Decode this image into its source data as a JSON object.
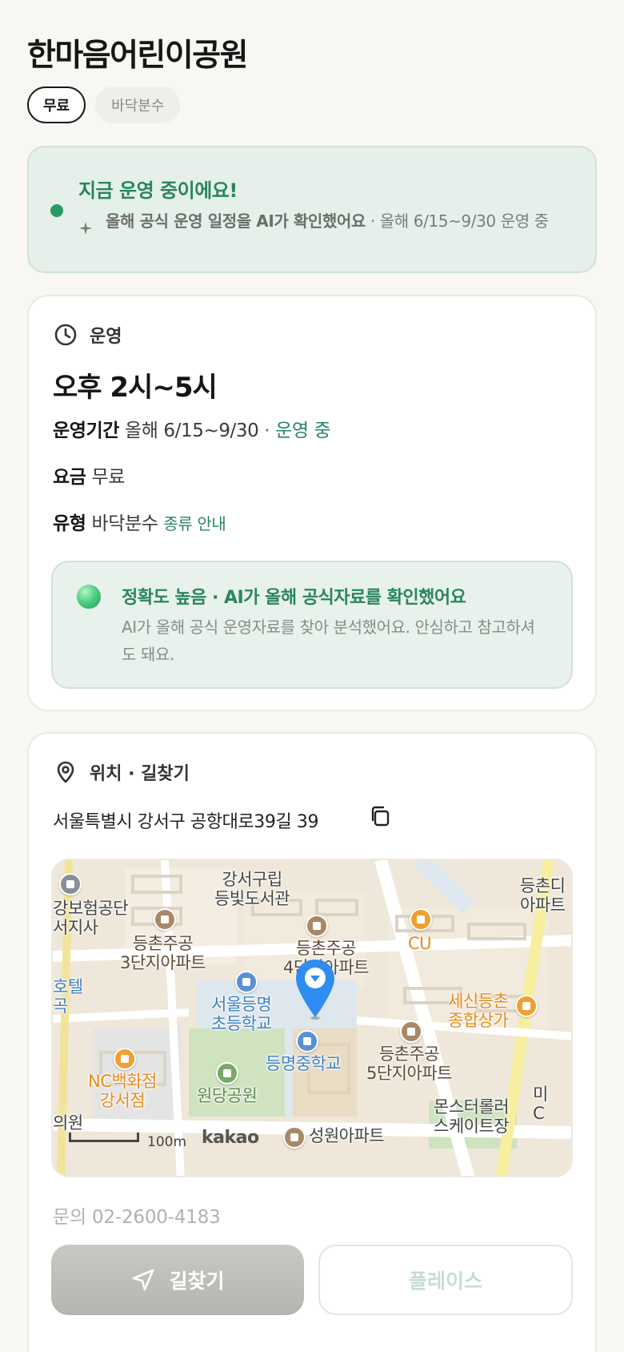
{
  "title": "한마음어린이공원",
  "chips": [
    "무료",
    "바닥분수"
  ],
  "status": {
    "title": "지금 운영 중이에요!",
    "detail_bold": "올해 공식 운영 일정을 AI가 확인했어요",
    "detail_rest": " · 올해 6/15~9/30 운영 중",
    "accent": "#2a8560"
  },
  "operation": {
    "section_label": "운영",
    "hours": "오후 2시~5시",
    "period_label": "운영기간",
    "period_value": "올해 6/15~9/30",
    "period_sep": " · ",
    "period_status": "운영 중",
    "fee_label": "요금",
    "fee_value": "무료",
    "type_label": "유형",
    "type_value": "바닥분수",
    "type_link": "종류 안내",
    "accuracy_title": "정확도 높음 · AI가 올해 공식자료를 확인했어요",
    "accuracy_desc": "AI가 올해 공식 운영자료를 찾아 분석했어요. 안심하고 참고하셔도 돼요."
  },
  "location": {
    "section_label": "위치 · 길찾기",
    "address": "서울특별시 강서구 공항대로39길 39",
    "contact": "문의 02-2600-4183",
    "map": {
      "scale": "100m",
      "provider": "kakao",
      "labels": {
        "library": "강서구립\n등빛도서관",
        "insurance": "강보험공단\n서지사",
        "apt3": "등촌주공\n3단지아파트",
        "apt4": "등촌주공\n4단지아파트",
        "cu": "CU",
        "apt_right": "등촌디\n아파트",
        "hotel": "호텔\n곡",
        "elementary": "서울등명\n초등학교",
        "market": "세신등촌\n종합상가",
        "middle": "등명중학교",
        "apt5": "등촌주공\n5단지아파트",
        "nc": "NC백화점\n강서점",
        "park": "원당공원",
        "rink": "몬스터롤러\n스케이트장",
        "seongwon": "성원아파트",
        "left_bottom": "의원",
        "right_edge": "미\nC"
      }
    }
  },
  "buttons": {
    "navigate": "길찾기",
    "place": "플레이스"
  }
}
